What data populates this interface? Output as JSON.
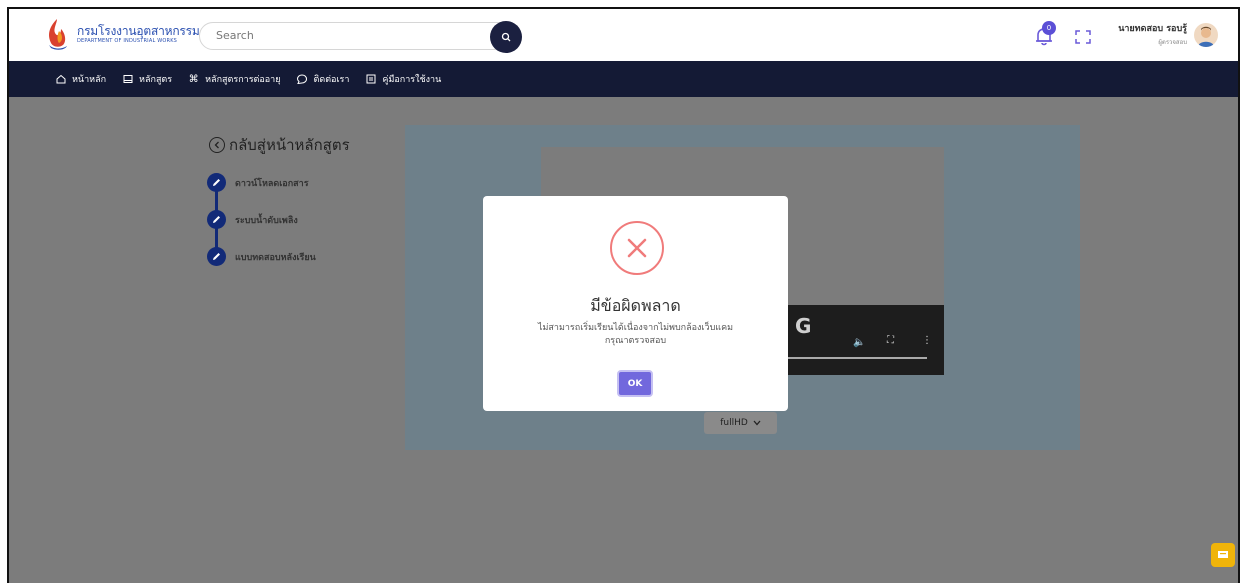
{
  "header": {
    "logo": {
      "title_th": "กรมโรงงานอุตสาหกรรม",
      "title_en": "DEPARTMENT OF INDUSTRIAL WORKS"
    },
    "search": {
      "placeholder": "Search"
    },
    "notifications": {
      "count": "0"
    },
    "user": {
      "name": "นายทดสอบ รอบรู้",
      "role": "ผู้ตรวจสอบ"
    }
  },
  "nav": {
    "items": [
      {
        "label": "หน้าหลัก",
        "icon": "home-icon"
      },
      {
        "label": "หลักสูตร",
        "icon": "book-icon"
      },
      {
        "label": "หลักสูตรการต่ออายุ",
        "icon": "command-icon"
      },
      {
        "label": "ติดต่อเรา",
        "icon": "chat-icon"
      },
      {
        "label": "คู่มือการใช้งาน",
        "icon": "manual-icon"
      }
    ]
  },
  "course": {
    "back_label": "กลับสู่หน้าหลักสูตร",
    "steps": [
      {
        "label": "ดาวน์โหลดเอกสาร"
      },
      {
        "label": "ระบบน้ำดับเพลิง"
      },
      {
        "label": "แบบทดสอบหลังเรียน"
      }
    ]
  },
  "video": {
    "overlay_text": "G",
    "quality": "fullHD"
  },
  "modal": {
    "title": "มีข้อผิดพลาด",
    "message_line1": "ไม่สามารถเริ่มเรียนได้เนื่องจากไม่พบกล้องเว็บแคม",
    "message_line2": "กรุณาตรวจสอบ",
    "ok_label": "OK"
  },
  "colors": {
    "nav_bg": "#141a35",
    "accent": "#7268dd",
    "error": "#f07b7b",
    "step": "#122a78"
  }
}
